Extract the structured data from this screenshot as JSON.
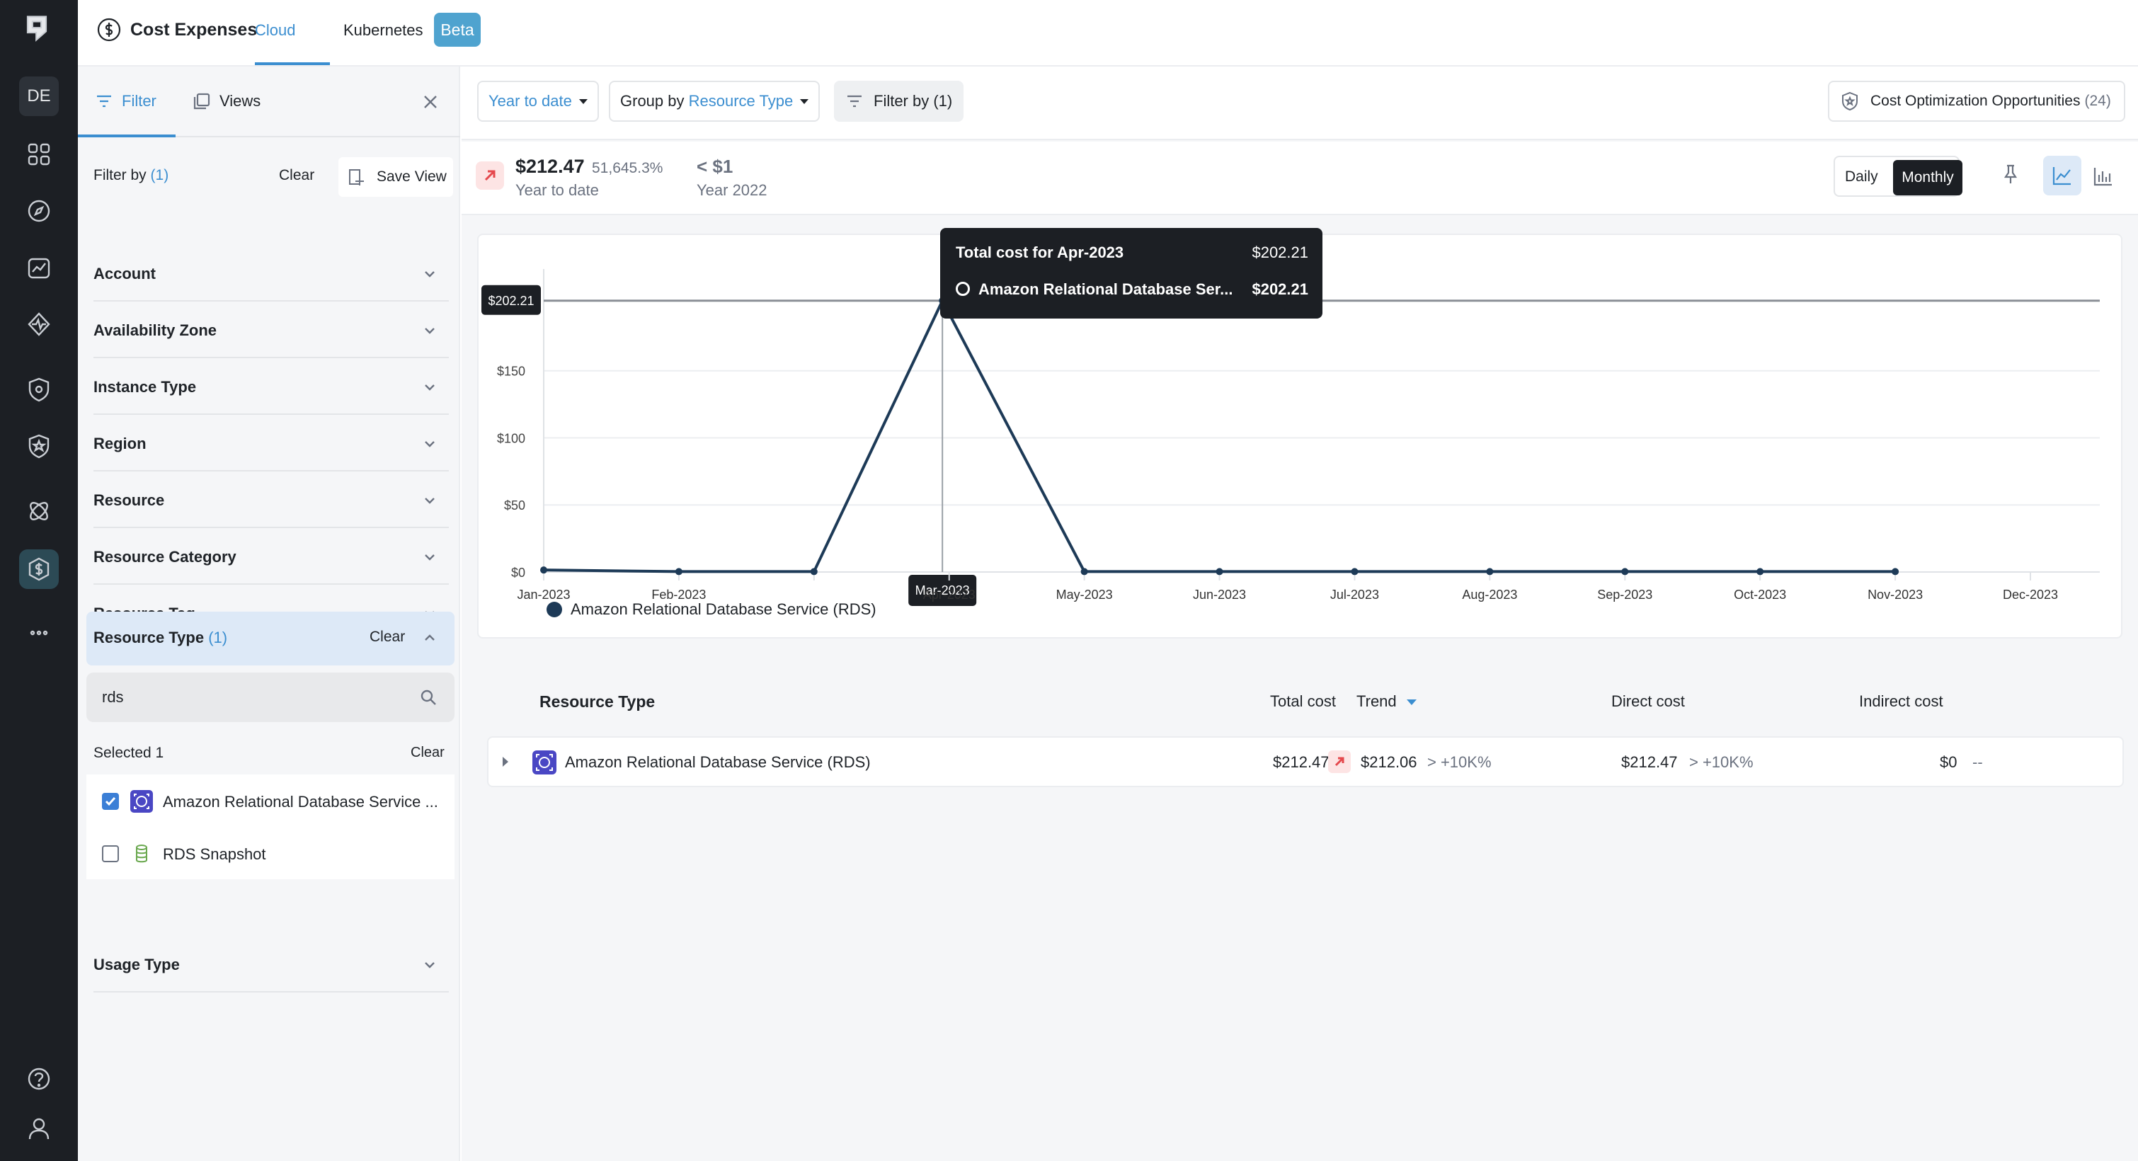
{
  "rail": {
    "workspace": "DE",
    "icons": [
      "home-logo-icon",
      "dashboard-grid-icon",
      "compass-icon",
      "analytics-icon",
      "activity-icon",
      "security-shield-icon",
      "star-shield-icon",
      "integrations-icon",
      "cost-dollar-icon",
      "more-icon",
      "help-icon",
      "user-icon"
    ]
  },
  "header": {
    "title": "Cost Expenses",
    "tabs": [
      {
        "label": "Cloud",
        "active": true
      },
      {
        "label": "Kubernetes",
        "active": false
      }
    ],
    "badge": "Beta"
  },
  "sidebar": {
    "tab_filter": "Filter",
    "tab_views": "Views",
    "filter_by_label": "Filter by",
    "filter_by_count": "(1)",
    "clear": "Clear",
    "save_view": "Save View",
    "facets": [
      "Account",
      "Availability Zone",
      "Instance Type",
      "Region",
      "Resource",
      "Resource Category",
      "Resource Tag"
    ],
    "open_facet": {
      "label": "Resource Type",
      "count": "(1)",
      "clear": "Clear"
    },
    "search_value": "rds",
    "selected_label": "Selected 1",
    "selected_clear": "Clear",
    "options": [
      {
        "label": "Amazon Relational Database Service ...",
        "checked": true
      },
      {
        "label": "RDS Snapshot",
        "checked": false
      }
    ],
    "last_facet": "Usage Type"
  },
  "toolbar": {
    "range": "Year to date",
    "group_prefix": "Group by",
    "group_value": "Resource Type",
    "filter": "Filter by (1)",
    "opportunities": "Cost Optimization Opportunities",
    "opportunities_count": "(24)"
  },
  "summary": {
    "amount": "$212.47",
    "change": "51,645.3%",
    "period": "Year to date",
    "prev_amount": "< $1",
    "prev_period": "Year 2022",
    "granularity": [
      "Daily",
      "Monthly"
    ],
    "active_granularity": "Monthly"
  },
  "chart_data": {
    "type": "line",
    "categories": [
      "Jan-2023",
      "Feb-2023",
      "Mar-2023",
      "Apr-2023",
      "May-2023",
      "Jun-2023",
      "Jul-2023",
      "Aug-2023",
      "Sep-2023",
      "Oct-2023",
      "Nov-2023",
      "Dec-2023"
    ],
    "series": [
      {
        "name": "Amazon Relational Database Service (RDS)",
        "values": [
          1.5,
          0.3,
          0.3,
          202.21,
          0.3,
          0.3,
          0.3,
          0.3,
          0.3,
          0.3,
          0.3,
          null
        ],
        "color": "#1d3a57"
      }
    ],
    "yticks": [
      "$0",
      "$50",
      "$100",
      "$150"
    ],
    "ylim": [
      0,
      210
    ],
    "reference_label": "$202.21",
    "hover_label": "Mar-2023",
    "grid": true,
    "legend": "bottom-left"
  },
  "tooltip": {
    "title": "Total cost for Apr-2023",
    "total": "$202.21",
    "series_name": "Amazon Relational Database Ser...",
    "series_value": "$202.21"
  },
  "table": {
    "headers": {
      "type": "Resource Type",
      "total": "Total cost",
      "trend": "Trend",
      "direct": "Direct cost",
      "indirect": "Indirect cost"
    },
    "rows": [
      {
        "name": "Amazon Relational Database Service (RDS)",
        "total": "$212.47",
        "trend_value": "$212.06",
        "trend_pct": "> +10K%",
        "direct": "$212.47",
        "direct_pct": "> +10K%",
        "indirect": "$0",
        "indirect_pct": "--"
      }
    ]
  }
}
